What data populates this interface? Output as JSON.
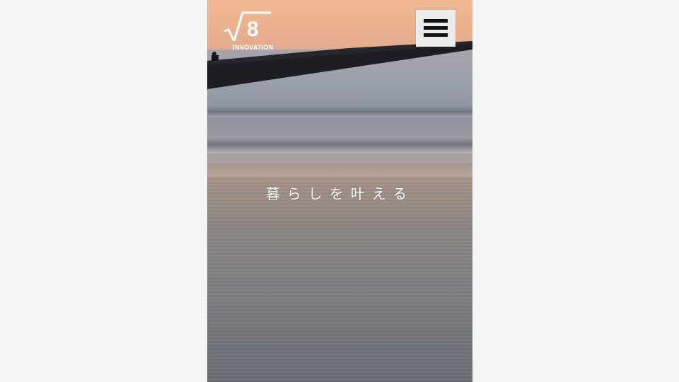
{
  "header": {
    "logo_symbol": "√8",
    "logo_digit": "8",
    "logo_brand": "INNOVATION",
    "menu_icon": "hamburger-menu-icon"
  },
  "hero": {
    "tagline": "暮らしを叶える"
  },
  "colors": {
    "page_background": "#f4f4f4",
    "menu_button_bg": "#ececec",
    "text": "#ffffff"
  }
}
